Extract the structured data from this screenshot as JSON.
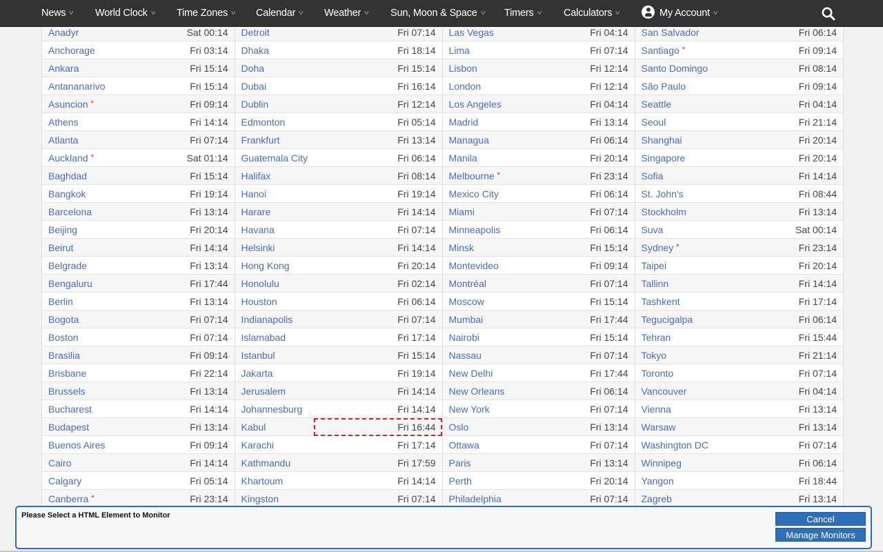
{
  "nav": {
    "items": [
      {
        "label": "News"
      },
      {
        "label": "World Clock"
      },
      {
        "label": "Time Zones"
      },
      {
        "label": "Calendar"
      },
      {
        "label": "Weather"
      },
      {
        "label": "Sun, Moon & Space"
      },
      {
        "label": "Timers"
      },
      {
        "label": "Calculators"
      },
      {
        "label": "My Account"
      }
    ],
    "search_icon": "search-icon",
    "account_icon": "user-circle-icon",
    "chevron_icon": "chevron-down-icon"
  },
  "colors": {
    "nav_bg": "#333333",
    "link": "#4a6bbf",
    "dst_marker": "#d22020",
    "monitor_accent": "#2f6fb8",
    "selection_outline": "#e02020"
  },
  "world_clock": {
    "dst_marker": "*",
    "rows": [
      [
        [
          "Anadyr",
          "Sat 00:14",
          false
        ],
        [
          "Detroit",
          "Fri 07:14",
          false
        ],
        [
          "Las Vegas",
          "Fri 04:14",
          false
        ],
        [
          "San Salvador",
          "Fri 06:14",
          false
        ]
      ],
      [
        [
          "Anchorage",
          "Fri 03:14",
          false
        ],
        [
          "Dhaka",
          "Fri 18:14",
          false
        ],
        [
          "Lima",
          "Fri 07:14",
          false
        ],
        [
          "Santiago",
          "Fri 09:14",
          true
        ]
      ],
      [
        [
          "Ankara",
          "Fri 15:14",
          false
        ],
        [
          "Doha",
          "Fri 15:14",
          false
        ],
        [
          "Lisbon",
          "Fri 12:14",
          false
        ],
        [
          "Santo Domingo",
          "Fri 08:14",
          false
        ]
      ],
      [
        [
          "Antananarivo",
          "Fri 15:14",
          false
        ],
        [
          "Dubai",
          "Fri 16:14",
          false
        ],
        [
          "London",
          "Fri 12:14",
          false
        ],
        [
          "São Paulo",
          "Fri 09:14",
          false
        ]
      ],
      [
        [
          "Asuncion",
          "Fri 09:14",
          true
        ],
        [
          "Dublin",
          "Fri 12:14",
          false
        ],
        [
          "Los Angeles",
          "Fri 04:14",
          false
        ],
        [
          "Seattle",
          "Fri 04:14",
          false
        ]
      ],
      [
        [
          "Athens",
          "Fri 14:14",
          false
        ],
        [
          "Edmonton",
          "Fri 05:14",
          false
        ],
        [
          "Madrid",
          "Fri 13:14",
          false
        ],
        [
          "Seoul",
          "Fri 21:14",
          false
        ]
      ],
      [
        [
          "Atlanta",
          "Fri 07:14",
          false
        ],
        [
          "Frankfurt",
          "Fri 13:14",
          false
        ],
        [
          "Managua",
          "Fri 06:14",
          false
        ],
        [
          "Shanghai",
          "Fri 20:14",
          false
        ]
      ],
      [
        [
          "Auckland",
          "Sat 01:14",
          true
        ],
        [
          "Guatemala City",
          "Fri 06:14",
          false
        ],
        [
          "Manila",
          "Fri 20:14",
          false
        ],
        [
          "Singapore",
          "Fri 20:14",
          false
        ]
      ],
      [
        [
          "Baghdad",
          "Fri 15:14",
          false
        ],
        [
          "Halifax",
          "Fri 08:14",
          false
        ],
        [
          "Melbourne",
          "Fri 23:14",
          true
        ],
        [
          "Sofia",
          "Fri 14:14",
          false
        ]
      ],
      [
        [
          "Bangkok",
          "Fri 19:14",
          false
        ],
        [
          "Hanoi",
          "Fri 19:14",
          false
        ],
        [
          "Mexico City",
          "Fri 06:14",
          false
        ],
        [
          "St. John's",
          "Fri 08:44",
          false
        ]
      ],
      [
        [
          "Barcelona",
          "Fri 13:14",
          false
        ],
        [
          "Harare",
          "Fri 14:14",
          false
        ],
        [
          "Miami",
          "Fri 07:14",
          false
        ],
        [
          "Stockholm",
          "Fri 13:14",
          false
        ]
      ],
      [
        [
          "Beijing",
          "Fri 20:14",
          false
        ],
        [
          "Havana",
          "Fri 07:14",
          false
        ],
        [
          "Minneapolis",
          "Fri 06:14",
          false
        ],
        [
          "Suva",
          "Sat 00:14",
          false
        ]
      ],
      [
        [
          "Beirut",
          "Fri 14:14",
          false
        ],
        [
          "Helsinki",
          "Fri 14:14",
          false
        ],
        [
          "Minsk",
          "Fri 15:14",
          false
        ],
        [
          "Sydney",
          "Fri 23:14",
          true
        ]
      ],
      [
        [
          "Belgrade",
          "Fri 13:14",
          false
        ],
        [
          "Hong Kong",
          "Fri 20:14",
          false
        ],
        [
          "Montevideo",
          "Fri 09:14",
          false
        ],
        [
          "Taipei",
          "Fri 20:14",
          false
        ]
      ],
      [
        [
          "Bengaluru",
          "Fri 17:44",
          false
        ],
        [
          "Honolulu",
          "Fri 02:14",
          false
        ],
        [
          "Montréal",
          "Fri 07:14",
          false
        ],
        [
          "Tallinn",
          "Fri 14:14",
          false
        ]
      ],
      [
        [
          "Berlin",
          "Fri 13:14",
          false
        ],
        [
          "Houston",
          "Fri 06:14",
          false
        ],
        [
          "Moscow",
          "Fri 15:14",
          false
        ],
        [
          "Tashkent",
          "Fri 17:14",
          false
        ]
      ],
      [
        [
          "Bogota",
          "Fri 07:14",
          false
        ],
        [
          "Indianapolis",
          "Fri 07:14",
          false
        ],
        [
          "Mumbai",
          "Fri 17:44",
          false
        ],
        [
          "Tegucigalpa",
          "Fri 06:14",
          false
        ]
      ],
      [
        [
          "Boston",
          "Fri 07:14",
          false
        ],
        [
          "Islamabad",
          "Fri 17:14",
          false
        ],
        [
          "Nairobi",
          "Fri 15:14",
          false
        ],
        [
          "Tehran",
          "Fri 15:44",
          false
        ]
      ],
      [
        [
          "Brasilia",
          "Fri 09:14",
          false
        ],
        [
          "Istanbul",
          "Fri 15:14",
          false
        ],
        [
          "Nassau",
          "Fri 07:14",
          false
        ],
        [
          "Tokyo",
          "Fri 21:14",
          false
        ]
      ],
      [
        [
          "Brisbane",
          "Fri 22:14",
          false
        ],
        [
          "Jakarta",
          "Fri 19:14",
          false
        ],
        [
          "New Delhi",
          "Fri 17:44",
          false
        ],
        [
          "Toronto",
          "Fri 07:14",
          false
        ]
      ],
      [
        [
          "Brussels",
          "Fri 13:14",
          false
        ],
        [
          "Jerusalem",
          "Fri 14:14",
          false
        ],
        [
          "New Orleans",
          "Fri 06:14",
          false
        ],
        [
          "Vancouver",
          "Fri 04:14",
          false
        ]
      ],
      [
        [
          "Bucharest",
          "Fri 14:14",
          false
        ],
        [
          "Johannesburg",
          "Fri 14:14",
          false
        ],
        [
          "New York",
          "Fri 07:14",
          false
        ],
        [
          "Vienna",
          "Fri 13:14",
          false
        ]
      ],
      [
        [
          "Budapest",
          "Fri 13:14",
          false
        ],
        [
          "Kabul",
          "Fri 16:44",
          false
        ],
        [
          "Oslo",
          "Fri 13:14",
          false
        ],
        [
          "Warsaw",
          "Fri 13:14",
          false
        ]
      ],
      [
        [
          "Buenos Aires",
          "Fri 09:14",
          false
        ],
        [
          "Karachi",
          "Fri 17:14",
          false
        ],
        [
          "Ottawa",
          "Fri 07:14",
          false
        ],
        [
          "Washington DC",
          "Fri 07:14",
          false
        ]
      ],
      [
        [
          "Cairo",
          "Fri 14:14",
          false
        ],
        [
          "Kathmandu",
          "Fri 17:59",
          false
        ],
        [
          "Paris",
          "Fri 13:14",
          false
        ],
        [
          "Winnipeg",
          "Fri 06:14",
          false
        ]
      ],
      [
        [
          "Calgary",
          "Fri 05:14",
          false
        ],
        [
          "Khartoum",
          "Fri 14:14",
          false
        ],
        [
          "Perth",
          "Fri 20:14",
          false
        ],
        [
          "Yangon",
          "Fri 18:44",
          false
        ]
      ],
      [
        [
          "Canberra",
          "Fri 23:14",
          true
        ],
        [
          "Kingston",
          "Fri 07:14",
          false
        ],
        [
          "Philadelphia",
          "Fri 07:14",
          false
        ],
        [
          "Zagreb",
          "Fri 13:14",
          false
        ]
      ]
    ],
    "selected_cell": {
      "row": 22,
      "col": 1,
      "city": "Kabul",
      "time": "Fri 16:44"
    }
  },
  "monitor_panel": {
    "message": "Please Select a HTML Element to Monitor",
    "cancel_label": "Cancel",
    "manage_label": "Manage Monitors"
  }
}
